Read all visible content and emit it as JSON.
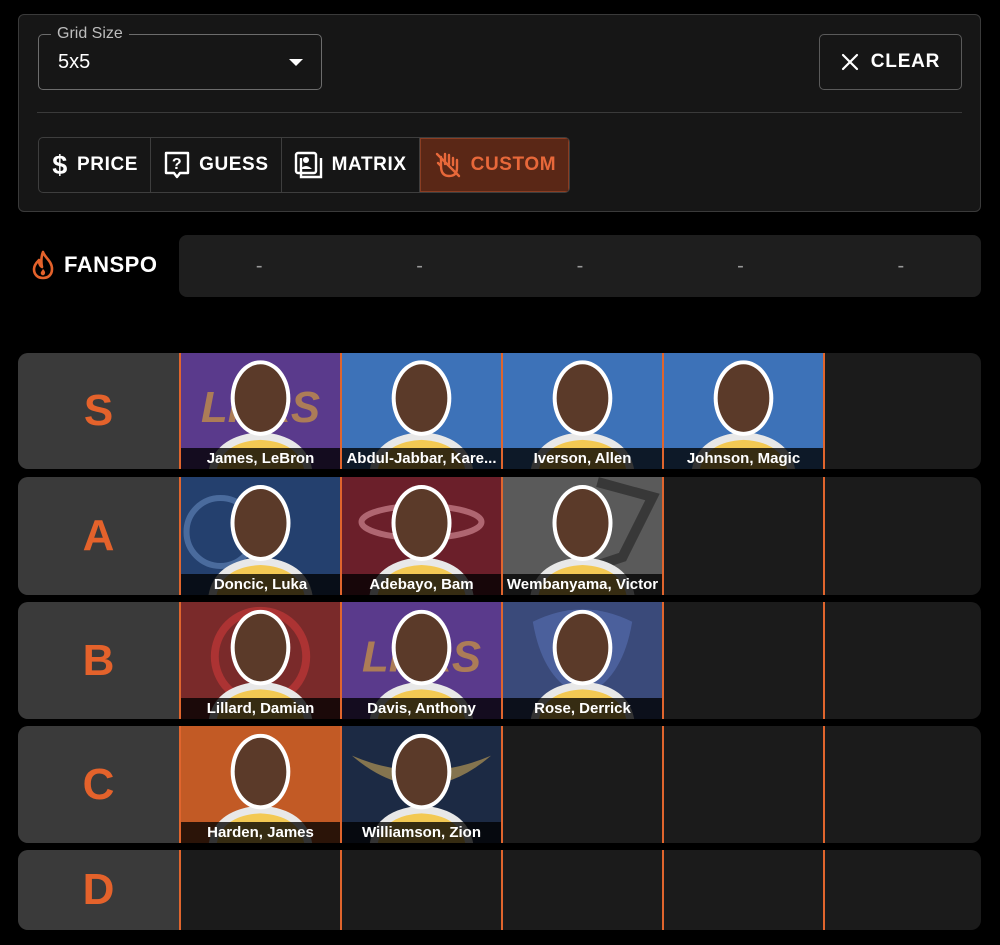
{
  "grid_size": {
    "legend": "Grid Size",
    "value": "5x5"
  },
  "clear_button": {
    "label": "CLEAR"
  },
  "modes": [
    {
      "label": "PRICE",
      "icon": "dollar-icon",
      "active": false
    },
    {
      "label": "GUESS",
      "icon": "question-box-icon",
      "active": false
    },
    {
      "label": "MATRIX",
      "icon": "matrix-icon",
      "active": false
    },
    {
      "label": "CUSTOM",
      "icon": "hand-icon",
      "active": true
    }
  ],
  "brand": {
    "name": "FANSPO",
    "icon": "flame-icon"
  },
  "dash_slots": [
    "-",
    "-",
    "-",
    "-",
    "-"
  ],
  "colors": {
    "accent": "#e4622b",
    "active_mode_bg": "#5a2716"
  },
  "tiers": [
    {
      "label": "S",
      "players": [
        {
          "name": "James, LeBron",
          "bg": "#5a3a8c",
          "logo": "lakers"
        },
        {
          "name": "Abdul-Jabbar, Kare...",
          "bg": "#3d72b8",
          "logo": "none"
        },
        {
          "name": "Iverson, Allen",
          "bg": "#3d72b8",
          "logo": "none"
        },
        {
          "name": "Johnson, Magic",
          "bg": "#3d72b8",
          "logo": "none"
        }
      ]
    },
    {
      "label": "A",
      "players": [
        {
          "name": "Doncic, Luka",
          "bg": "#24406e",
          "logo": "mavs"
        },
        {
          "name": "Adebayo, Bam",
          "bg": "#6b1f2a",
          "logo": "heat"
        },
        {
          "name": "Wembanyama, Victor",
          "bg": "#5a5a5a",
          "logo": "spurs"
        }
      ]
    },
    {
      "label": "B",
      "players": [
        {
          "name": "Lillard, Damian",
          "bg": "#7a2a2a",
          "logo": "blazers"
        },
        {
          "name": "Davis, Anthony",
          "bg": "#5a3a8c",
          "logo": "lakers"
        },
        {
          "name": "Rose, Derrick",
          "bg": "#3a4a7a",
          "logo": "grizzlies"
        }
      ]
    },
    {
      "label": "C",
      "players": [
        {
          "name": "Harden, James",
          "bg": "#c25a25",
          "logo": "none"
        },
        {
          "name": "Williamson, Zion",
          "bg": "#1c2a44",
          "logo": "pelicans"
        }
      ]
    },
    {
      "label": "D",
      "players": []
    }
  ]
}
